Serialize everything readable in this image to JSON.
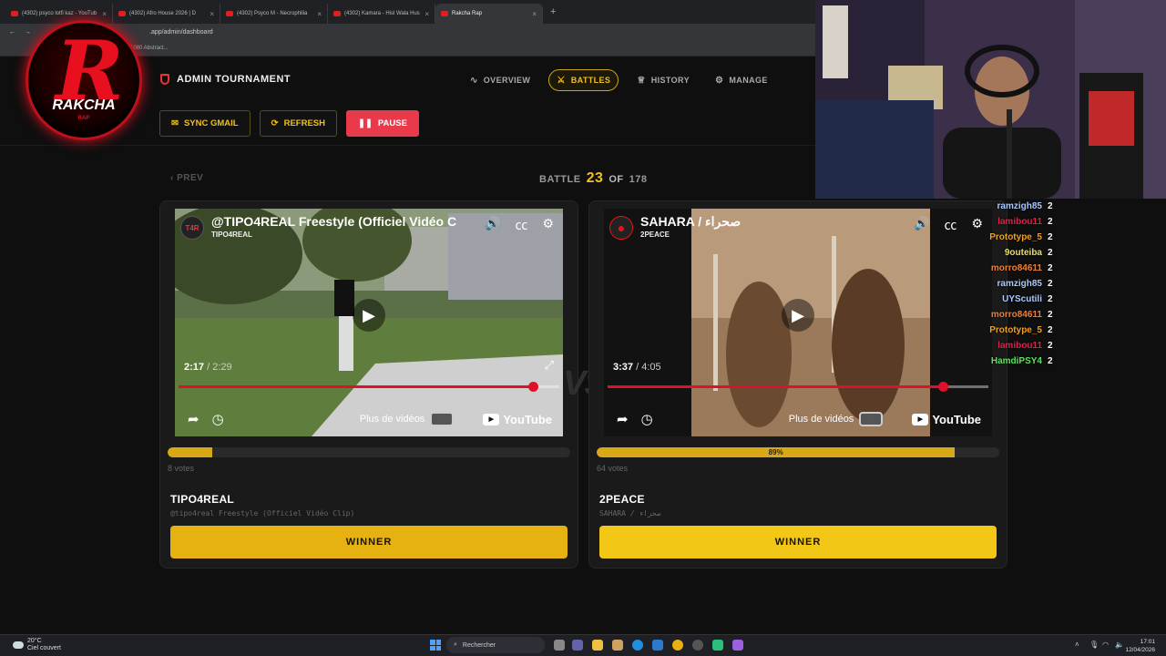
{
  "browser": {
    "tabs": [
      {
        "label": "(4302) psyco lotfi kaz - YouTub"
      },
      {
        "label": "(4302) Afro House 2026 | D"
      },
      {
        "label": "(4302) Psyco M - Necrophilia"
      },
      {
        "label": "(4302) Kamara - Hisl Wala Hus"
      },
      {
        "label": "Rakcha Rap",
        "active": true
      }
    ],
    "url": ".app/admin/dashboard",
    "bookmark": "x1080 Abstract..."
  },
  "logo": {
    "word": "RAKCHA",
    "sub": "RAP",
    "letter": "R"
  },
  "header": {
    "title": "ADMIN TOURNAMENT",
    "nav": [
      {
        "label": "OVERVIEW",
        "icon": "pulse-icon",
        "glyph": "∿"
      },
      {
        "label": "BATTLES",
        "icon": "swords-icon",
        "glyph": "⚔",
        "active": true
      },
      {
        "label": "HISTORY",
        "icon": "trophy-icon",
        "glyph": "♕"
      },
      {
        "label": "MANAGE",
        "icon": "gear-icon",
        "glyph": "⚙"
      }
    ],
    "actions": {
      "sync": "SYNC GMAIL",
      "refresh": "REFRESH",
      "pause": "PAUSE"
    }
  },
  "battle": {
    "prev": "‹ PREV",
    "label": "BATTLE",
    "current": "23",
    "of": "OF",
    "total": "178",
    "vs": "VS"
  },
  "left": {
    "video_title": "@TIPO4REAL Freestyle (Officiel Vidéo C",
    "channel": "TIPO4REAL",
    "avatar": "T4R",
    "time_current": "2:17",
    "time_total": " / 2:29",
    "progress": 0.93,
    "more_videos": "Plus de vidéos",
    "youtube": "YouTube",
    "vote_fraction": 0.11,
    "vote_label": "",
    "votes": "8 votes",
    "artist": "TIPO4REAL",
    "song": "@tipo4real Freestyle (Officiel Vidéo Clip)",
    "winner": "WINNER"
  },
  "right": {
    "video_title": "SAHARA / صحراء",
    "channel": "2PEACE",
    "avatar": "",
    "time_current": "3:37",
    "time_total": " / 4:05",
    "progress": 0.88,
    "more_videos": "Plus de vidéos",
    "youtube": "YouTube",
    "vote_fraction": 0.89,
    "vote_label": "89%",
    "votes": "64 votes",
    "artist": "2PEACE",
    "song": "SAHARA / صحراء",
    "winner": "WINNER"
  },
  "chat": [
    {
      "name": "ramzigh85",
      "count": "2",
      "color": "#a8c8ff"
    },
    {
      "name": "lamibou11",
      "count": "2",
      "color": "#e0204a"
    },
    {
      "name": "Prototype_5",
      "count": "2",
      "color": "#f0a020"
    },
    {
      "name": "9outeiba",
      "count": "2",
      "color": "#e8e060"
    },
    {
      "name": "morro84611",
      "count": "2",
      "color": "#f08030"
    },
    {
      "name": "ramzigh85",
      "count": "2",
      "color": "#a8c8ff"
    },
    {
      "name": "UYScutili",
      "count": "2",
      "color": "#a8c8ff"
    },
    {
      "name": "morro84611",
      "count": "2",
      "color": "#f08030"
    },
    {
      "name": "Prototype_5",
      "count": "2",
      "color": "#f0a020"
    },
    {
      "name": "lamibou11",
      "count": "2",
      "color": "#e0204a"
    },
    {
      "name": "HamdiPSY4",
      "count": "2",
      "color": "#60e060"
    }
  ],
  "taskbar": {
    "temp": "20°C",
    "weather": "Ciel couvert",
    "search": "Rechercher",
    "time": "17:01",
    "date": "12/04/2026"
  }
}
